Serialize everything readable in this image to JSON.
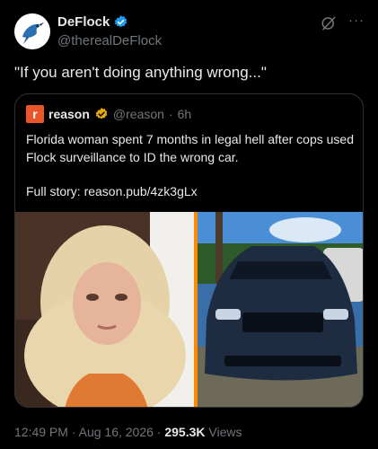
{
  "author": {
    "display_name": "DeFlock",
    "handle": "@therealDeFlock",
    "avatar_icon": "bird-camera-logo",
    "verified_color": "#1d9bf0"
  },
  "tweet": {
    "text": "\"If you aren't doing anything wrong...\""
  },
  "quote": {
    "logo_letter": "r",
    "author_name": "reason",
    "author_handle": "@reason",
    "separator": "·",
    "time_ago": "6h",
    "verified_color": "#e8a90b",
    "text": "Florida woman spent 7 months in legal hell after cops used Flock surveillance to ID the wrong car.",
    "link_text": "Full story: reason.pub/4zk3gLx",
    "accent_color": "#ff8a00"
  },
  "footer": {
    "time": "12:49 PM",
    "dot1": " · ",
    "date": "Aug 16, 2026",
    "dot2": " · ",
    "views_count": "295.3K",
    "views_label": " Views"
  }
}
